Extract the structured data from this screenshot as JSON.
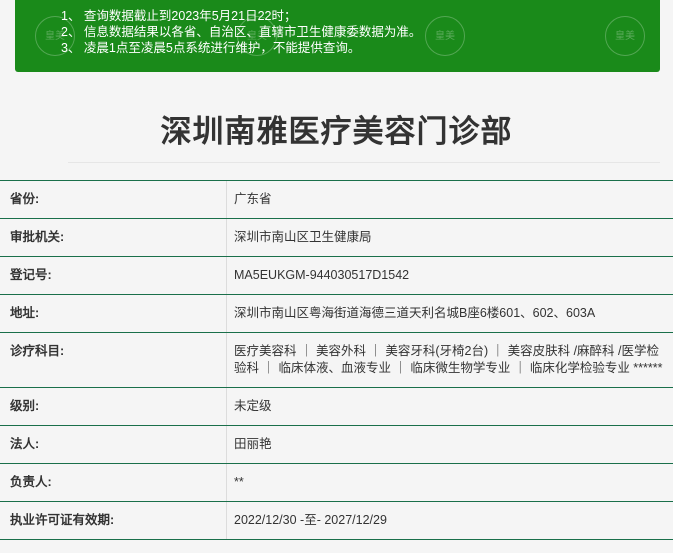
{
  "notice": {
    "lines": [
      "1、 查询数据截止到2023年5月21日22时；",
      "2、 信息数据结果以各省、自治区、直辖市卫生健康委数据为准。",
      "3、 凌晨1点至凌晨5点系统进行维护，不能提供查询。"
    ],
    "watermark": "皇美"
  },
  "title": "深圳南雅医疗美容门诊部",
  "rows": [
    {
      "label": "省份:",
      "value": "广东省"
    },
    {
      "label": "审批机关:",
      "value": "深圳市南山区卫生健康局"
    },
    {
      "label": "登记号:",
      "value": "MA5EUKGM-944030517D1542"
    },
    {
      "label": "地址:",
      "value": "深圳市南山区粤海街道海德三道天利名城B座6楼601、602、603A"
    },
    {
      "label": "诊疗科目:",
      "value": "医疗美容科 ｜ 美容外科 ｜ 美容牙科(牙椅2台) ｜ 美容皮肤科 /麻醉科 /医学检验科 ｜ 临床体液、血液专业 ｜ 临床微生物学专业 ｜ 临床化学检验专业 ******"
    },
    {
      "label": "级别:",
      "value": "未定级"
    },
    {
      "label": "法人:",
      "value": "田丽艳"
    },
    {
      "label": "负责人:",
      "value": "**"
    },
    {
      "label": "执业许可证有效期:",
      "value": "2022/12/30 -至- 2027/12/29"
    }
  ]
}
